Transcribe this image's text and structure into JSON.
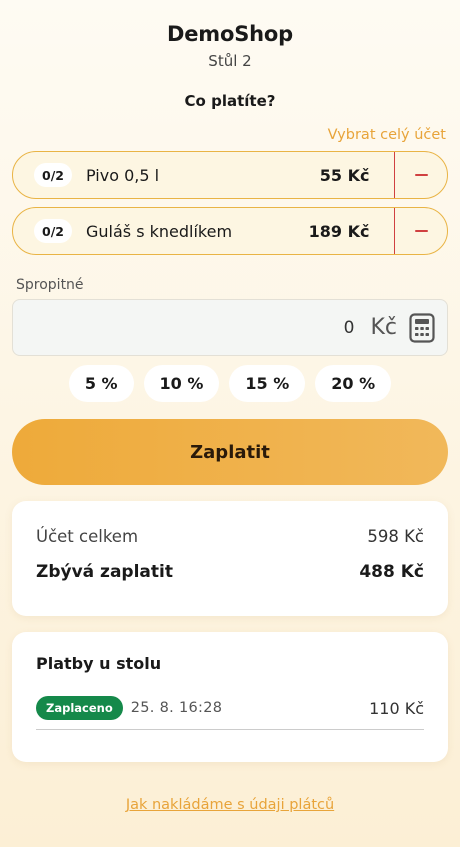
{
  "header": {
    "shop_name": "DemoShop",
    "table_name": "Stůl 2"
  },
  "question": "Co platíte?",
  "select_all_label": "Vybrat celý účet",
  "items": [
    {
      "qty": "0/2",
      "name": "Pivo 0,5 l",
      "price": "55 Kč"
    },
    {
      "qty": "0/2",
      "name": "Guláš s knedlíkem",
      "price": "189 Kč"
    }
  ],
  "tip": {
    "label": "Spropitné",
    "value": "0",
    "currency": "Kč",
    "icon": "calculator-icon",
    "presets": [
      "5 %",
      "10 %",
      "15 %",
      "20 %"
    ]
  },
  "pay_button_label": "Zaplatit",
  "summary": {
    "total_label": "Účet celkem",
    "total_value": "598 Kč",
    "remaining_label": "Zbývá zaplatit",
    "remaining_value": "488 Kč"
  },
  "payments": {
    "title": "Platby u stolu",
    "rows": [
      {
        "status": "Zaplaceno",
        "time": "25. 8. 16:28",
        "amount": "110 Kč"
      }
    ]
  },
  "privacy_link": "Jak nakládáme s údaji plátců",
  "colors": {
    "accent": "#e8a43a",
    "pay_button": "#eeaa3a",
    "item_border": "#e9b445",
    "minus_red": "#d04040",
    "paid_green": "#15894a"
  }
}
